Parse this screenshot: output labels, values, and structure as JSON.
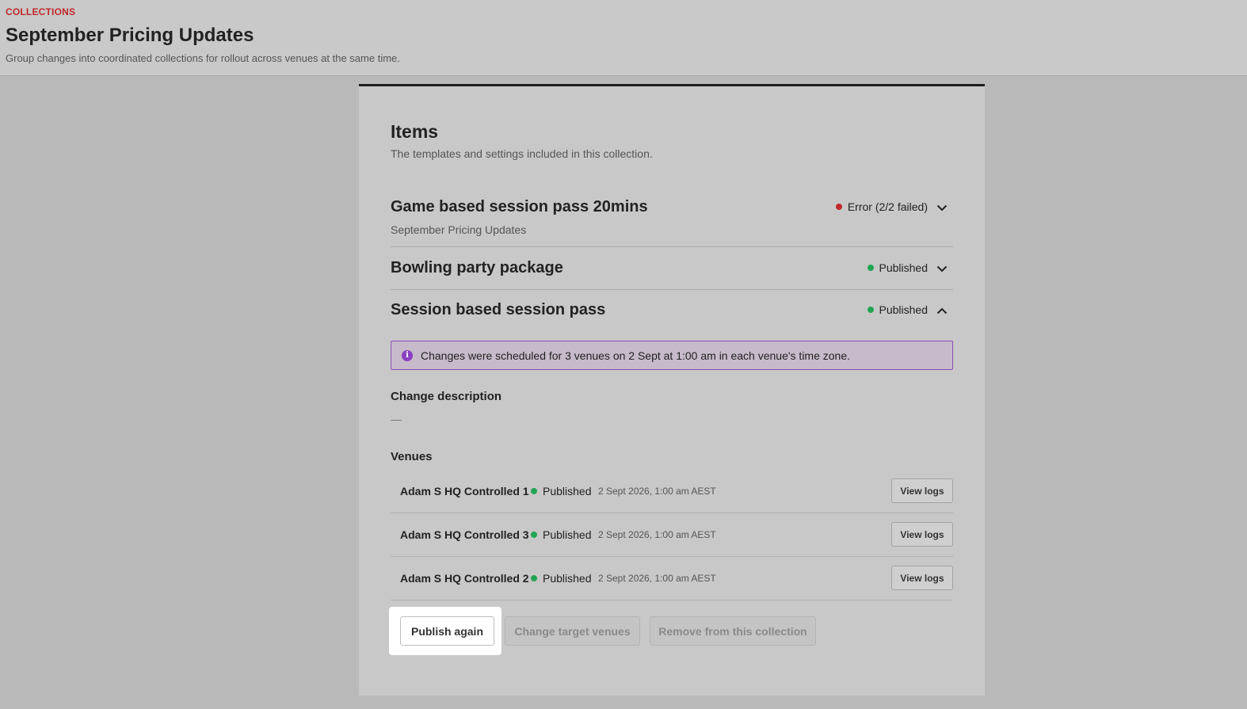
{
  "header": {
    "eyebrow": "COLLECTIONS",
    "title": "September Pricing Updates",
    "subtitle": "Group changes into coordinated collections for rollout across venues at the same time."
  },
  "section": {
    "title": "Items",
    "subtitle": "The templates and settings included in this collection."
  },
  "items": [
    {
      "title": "Game based session pass 20mins",
      "subtitle": "September Pricing Updates",
      "status": "Error (2/2 failed)",
      "status_color": "#c0282b",
      "expanded": false
    },
    {
      "title": "Bowling party package",
      "status": "Published",
      "status_color": "#22a455",
      "expanded": false
    },
    {
      "title": "Session based session pass",
      "status": "Published",
      "status_color": "#22a455",
      "expanded": true
    }
  ],
  "banner": {
    "icon": "info-icon",
    "text": "Changes were scheduled for 3 venues on 2 Sept at 1:00 am in each venue's time zone."
  },
  "change_description": {
    "heading": "Change description",
    "value": "—"
  },
  "venues": {
    "heading": "Venues",
    "rows": [
      {
        "name": "Adam S HQ Controlled 1",
        "status": "Published",
        "time": "2 Sept 2026, 1:00 am AEST",
        "button": "View logs"
      },
      {
        "name": "Adam S HQ Controlled 3",
        "status": "Published",
        "time": "2 Sept 2026, 1:00 am AEST",
        "button": "View logs"
      },
      {
        "name": "Adam S HQ Controlled 2",
        "status": "Published",
        "time": "2 Sept 2026, 1:00 am AEST",
        "button": "View logs"
      }
    ]
  },
  "actions": {
    "publish_again": "Publish again",
    "change_target": "Change target venues",
    "remove": "Remove from this collection"
  },
  "colors": {
    "accent_red": "#c0282b",
    "published_green": "#22a455",
    "info_purple": "#8a3fc0"
  }
}
